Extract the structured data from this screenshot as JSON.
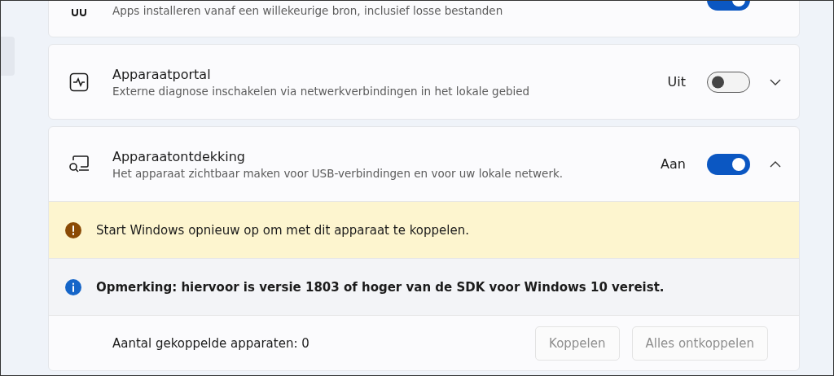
{
  "sidebar": {
    "items": [
      {
        "selected": true
      }
    ]
  },
  "cards": [
    {
      "description": "Apps installeren vanaf een willekeurige bron, inclusief losse bestanden",
      "toggle": {
        "on": true
      }
    },
    {
      "title": "Apparaatportal",
      "description": "Externe diagnose inschakelen via netwerkverbindingen in het lokale gebied",
      "toggle": {
        "label": "Uit",
        "on": false
      },
      "expanded": false
    },
    {
      "title": "Apparaatontdekking",
      "description": "Het apparaat zichtbaar maken voor USB-verbindingen en voor uw lokale netwerk.",
      "toggle": {
        "label": "Aan",
        "on": true
      },
      "expanded": true,
      "messages": [
        {
          "kind": "warning",
          "text": "Start Windows opnieuw op om met dit apparaat te koppelen."
        },
        {
          "kind": "info",
          "text": "Opmerking: hiervoor is versie 1803 of hoger van de SDK voor Windows 10 vereist."
        }
      ],
      "footer": {
        "label": "Aantal gekoppelde apparaten: 0",
        "buttons": [
          {
            "label": "Koppelen",
            "disabled": true
          },
          {
            "label": "Alles ontkoppelen",
            "disabled": true
          }
        ]
      }
    }
  ]
}
